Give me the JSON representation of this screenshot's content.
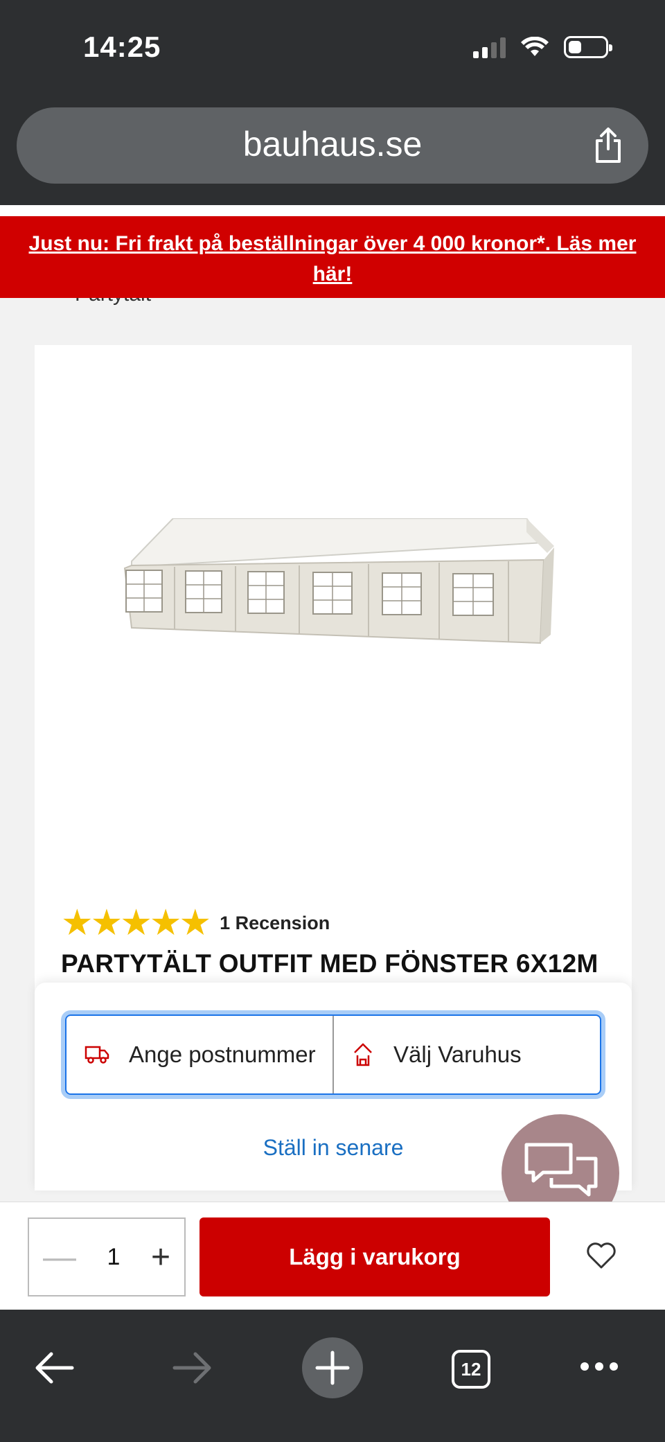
{
  "status_bar": {
    "time": "14:25",
    "battery_level": 0.35
  },
  "browser": {
    "url": "bauhaus.se",
    "tab_count": "12"
  },
  "banner": {
    "text": "Just nu: Fri frakt på beställningar över 4 000 kronor*. Läs mer här!"
  },
  "breadcrumb": {
    "text": "Partytält"
  },
  "product": {
    "title": "PARTYTÄLT OUTFIT MED FÖNSTER 6X12M",
    "rating": 5,
    "max_rating": 5,
    "review_count_label": "1 Recension"
  },
  "delivery": {
    "postcode_label": "Ange postnummer",
    "store_label": "Välj Varuhus",
    "later_label": "Ställ in senare"
  },
  "cart": {
    "quantity": "1",
    "add_label": "Lägg i varukorg"
  },
  "colors": {
    "brand_red": "#cc0000",
    "link_blue": "#1a6fc2",
    "star": "#f5c000"
  }
}
